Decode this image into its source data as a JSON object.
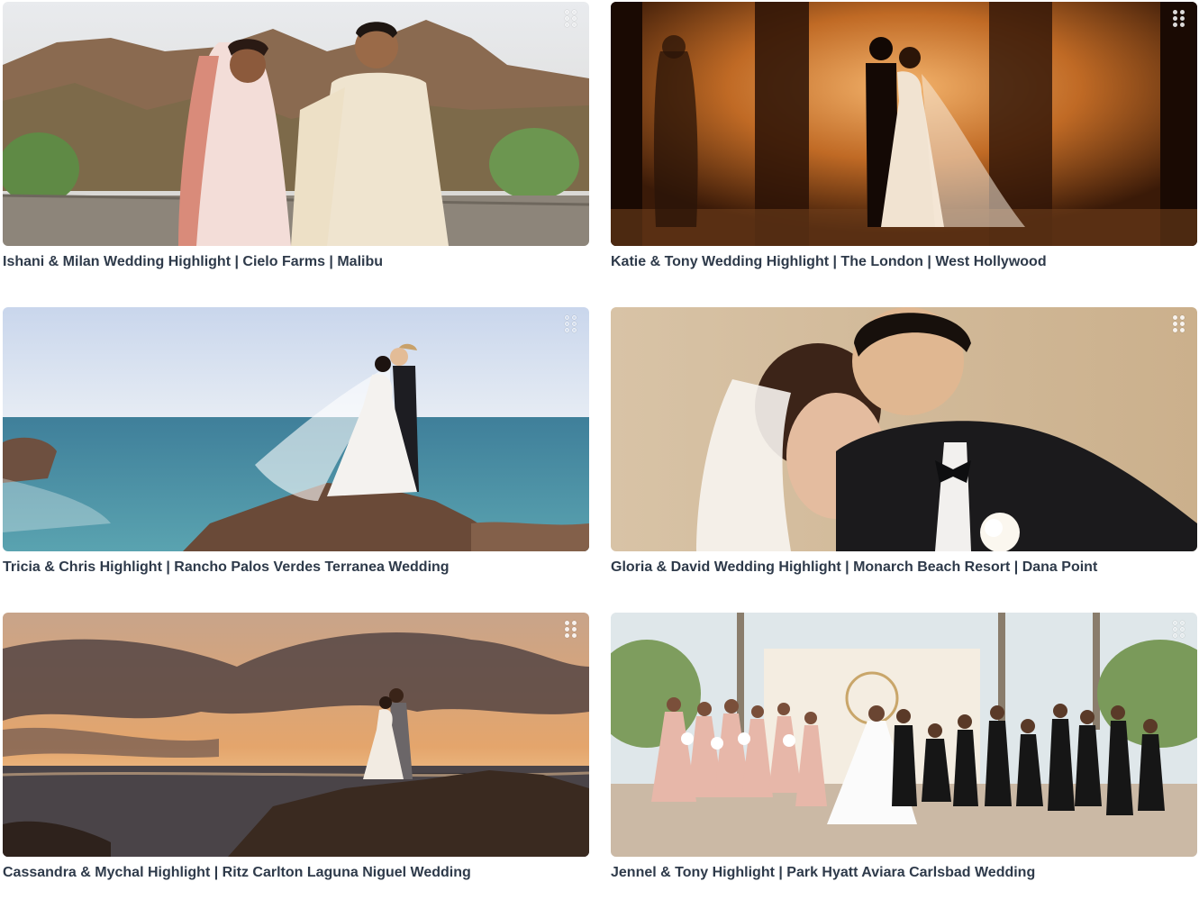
{
  "videos": [
    {
      "title": "Ishani & Milan Wedding Highlight | Cielo Farms | Malibu",
      "thumbnail": "bride-and-groom-indian-attire-mountains",
      "menu_icon": "drag-handle-icon"
    },
    {
      "title": "Katie & Tony Wedding Highlight | The London | West Hollywood",
      "thumbnail": "couple-silhouette-golden-hallway",
      "menu_icon": "drag-handle-icon"
    },
    {
      "title": "Tricia & Chris Highlight | Rancho Palos Verdes Terranea Wedding",
      "thumbnail": "couple-on-rocks-by-ocean",
      "menu_icon": "drag-handle-icon"
    },
    {
      "title": "Gloria & David Wedding Highlight | Monarch Beach Resort | Dana Point",
      "thumbnail": "groom-kissing-bride-forehead",
      "menu_icon": "drag-handle-icon"
    },
    {
      "title": "Cassandra & Mychal Highlight | Ritz Carlton Laguna Niguel Wedding",
      "thumbnail": "couple-on-rocks-at-sunset",
      "menu_icon": "drag-handle-icon"
    },
    {
      "title": "Jennel & Tony Highlight | Park Hyatt Aviara Carlsbad Wedding",
      "thumbnail": "wedding-party-group-flower-wall",
      "menu_icon": "drag-handle-icon"
    }
  ],
  "colors": {
    "caption": "#2e3a4a",
    "background": "#ffffff"
  }
}
